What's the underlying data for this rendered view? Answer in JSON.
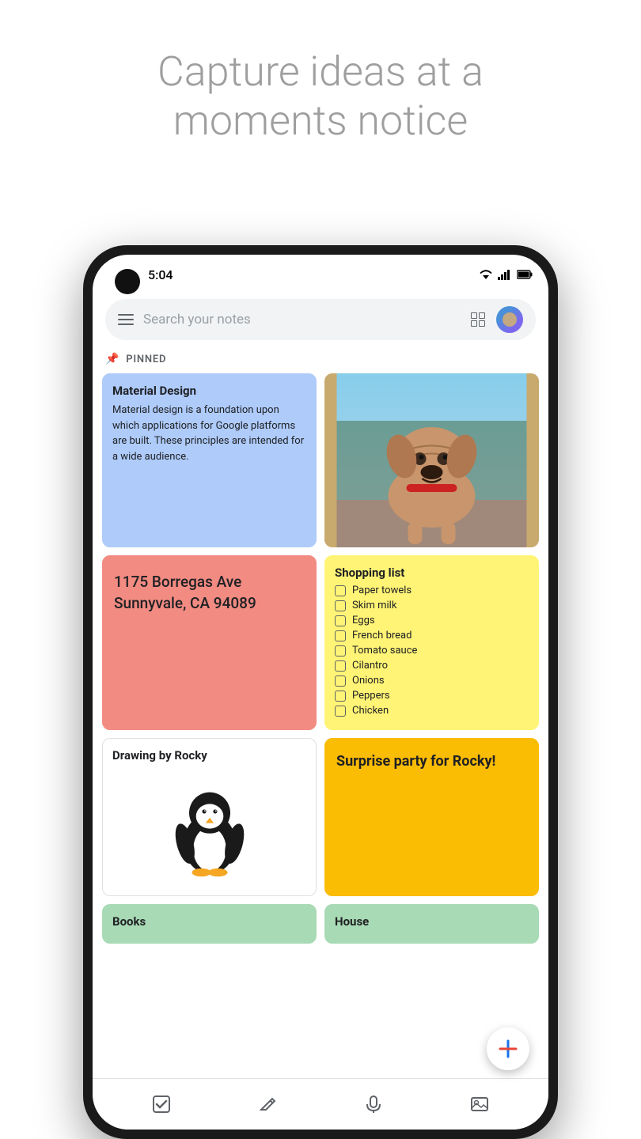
{
  "header": {
    "line1": "Capture ideas at a",
    "line2": "moments notice"
  },
  "statusBar": {
    "time": "5:04",
    "icons": "wifi signal battery"
  },
  "searchBar": {
    "placeholder": "Search your notes"
  },
  "pinnedLabel": "PINNED",
  "notes": [
    {
      "id": "material-design",
      "color": "blue",
      "title": "Material Design",
      "body": "Material design is a foundation upon which applications for Google platforms are built. These principles are intended for a wide audience.",
      "type": "text"
    },
    {
      "id": "dog-photo",
      "color": "white",
      "title": "",
      "body": "",
      "type": "image"
    },
    {
      "id": "address",
      "color": "salmon",
      "title": "",
      "body": "1175 Borregas Ave Sunnyvale, CA 94089",
      "type": "address"
    },
    {
      "id": "shopping-list",
      "color": "yellow",
      "title": "Shopping list",
      "type": "checklist",
      "items": [
        "Paper towels",
        "Skim milk",
        "Eggs",
        "French bread",
        "Tomato sauce",
        "Cilantro",
        "Onions",
        "Peppers",
        "Chicken"
      ]
    },
    {
      "id": "drawing-rocky",
      "color": "white",
      "title": "Drawing by Rocky",
      "type": "drawing"
    },
    {
      "id": "surprise-party",
      "color": "amber",
      "title": "Surprise party for Rocky!",
      "type": "text",
      "body": ""
    },
    {
      "id": "books",
      "color": "teal",
      "title": "Books",
      "type": "text",
      "body": ""
    },
    {
      "id": "house",
      "color": "teal",
      "title": "House",
      "type": "text",
      "body": ""
    }
  ],
  "fab": {
    "label": "+"
  },
  "toolbar": {
    "items": [
      "checkbox",
      "pencil",
      "microphone",
      "image"
    ]
  }
}
